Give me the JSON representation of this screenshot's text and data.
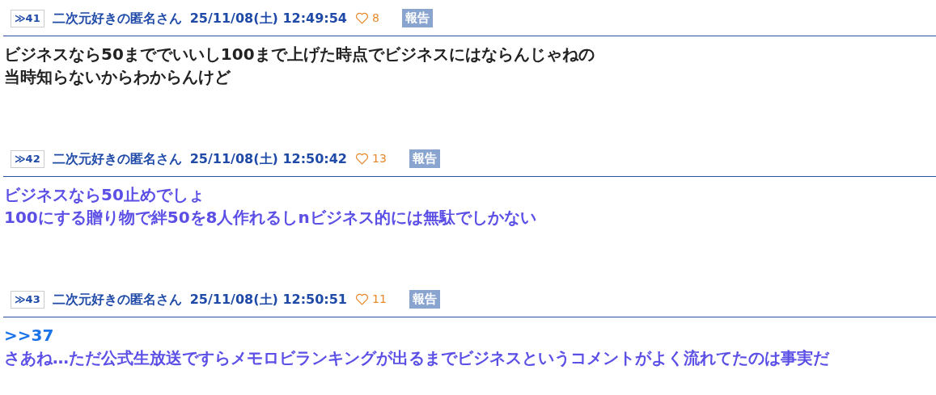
{
  "posts": [
    {
      "number": "≫41",
      "name": "二次元好きの匿名さん",
      "date": "25/11/08(土) 12:49:54",
      "likes": "8",
      "report": "報告",
      "color": "#222222",
      "lines": [
        {
          "kind": "text",
          "text": "ビジネスなら50まででいいし100まで上げた時点でビジネスにはならんじゃねの"
        },
        {
          "kind": "text",
          "text": "当時知らないからわからんけど"
        }
      ]
    },
    {
      "number": "≫42",
      "name": "二次元好きの匿名さん",
      "date": "25/11/08(土) 12:50:42",
      "likes": "13",
      "report": "報告",
      "color": "#5b4fe6",
      "lines": [
        {
          "kind": "text",
          "text": "ビジネスなら50止めでしょ"
        },
        {
          "kind": "text",
          "text": "100にする贈り物で絆50を8人作れるしnビジネス的には無駄でしかない"
        }
      ]
    },
    {
      "number": "≫43",
      "name": "二次元好きの匿名さん",
      "date": "25/11/08(土) 12:50:51",
      "likes": "11",
      "report": "報告",
      "color": "#5b4fe6",
      "lines": [
        {
          "kind": "anchor",
          "text": ">>37"
        },
        {
          "kind": "text",
          "text": "さあね…ただ公式生放送ですらメモロビランキングが出るまでビジネスというコメントがよく流れてたのは事実だ"
        }
      ]
    }
  ]
}
